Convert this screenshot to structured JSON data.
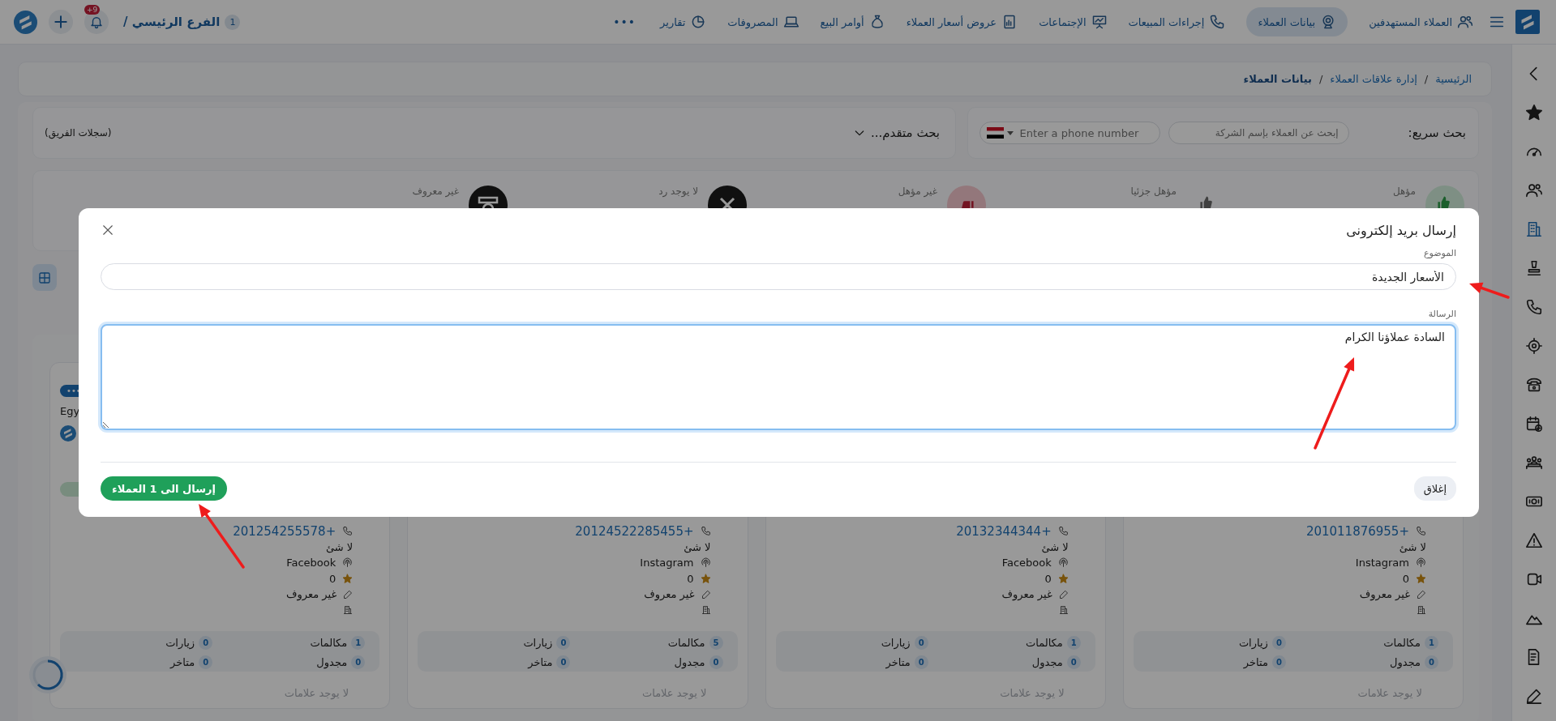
{
  "top_bar": {
    "nav": [
      {
        "label": "العملاء المستهدفين",
        "selected": false
      },
      {
        "label": "بيانات العملاء",
        "selected": true
      },
      {
        "label": "إجراءات المبيعات",
        "selected": false
      },
      {
        "label": "الإجتماعات",
        "selected": false
      },
      {
        "label": "عروض أسعار العملاء",
        "selected": false
      },
      {
        "label": "أوامر البيع",
        "selected": false
      },
      {
        "label": "المصروفات",
        "selected": false
      },
      {
        "label": "تقارير",
        "selected": false
      }
    ],
    "more": "•••",
    "branch_count": "1",
    "branch": "الفرع الرئيسي /",
    "notifications": "+9"
  },
  "sidebar": {
    "items": [
      {
        "selected": false
      },
      {
        "selected": false
      },
      {
        "selected": false
      },
      {
        "selected": false
      },
      {
        "selected": true
      },
      {
        "selected": false
      },
      {
        "selected": false
      },
      {
        "selected": false
      },
      {
        "selected": false
      },
      {
        "selected": false
      },
      {
        "selected": false
      },
      {
        "selected": false
      },
      {
        "selected": false
      },
      {
        "selected": false
      },
      {
        "selected": false
      },
      {
        "selected": false
      },
      {
        "selected": false
      }
    ]
  },
  "breadcrumb": {
    "items": [
      {
        "label": "الرئيسية",
        "current": false
      },
      {
        "label": "إدارة علاقات العملاء",
        "current": false
      },
      {
        "label": "بيانات العملاء",
        "current": true
      }
    ],
    "separators": [
      "/",
      "/"
    ]
  },
  "quick_search": {
    "label": "بحث سريع:",
    "company_placeholder": "إبحث عن العملاء بإسم الشركة",
    "phone_placeholder": "Enter a phone number"
  },
  "advanced_search": "بحث متقدم...",
  "team_records": "(سجلات الفريق)",
  "stats": [
    {
      "kind": "qualified",
      "label": "مؤهل"
    },
    {
      "kind": "partial",
      "label": "مؤهل جزئيا"
    },
    {
      "kind": "unqualified",
      "label": "غير مؤهل"
    },
    {
      "kind": "no_reply",
      "label": "لا يوجد رد"
    },
    {
      "kind": "unknown",
      "label": "غير معروف"
    }
  ],
  "cards": [
    {
      "phone": "+201011876955",
      "note": "لا شئ",
      "source": "Instagram",
      "rating": "0",
      "rank": "غير معروف",
      "calls_label": "مكالمات",
      "calls": "1",
      "visits_label": "زيارات",
      "visits": "0",
      "scheduled_label": "مجدول",
      "scheduled": "0",
      "late_label": "متاخر",
      "late": "0",
      "tags": "لا يوجد علامات"
    },
    {
      "phone": "+20132344344",
      "note": "لا شئ",
      "source": "Facebook",
      "rating": "0",
      "rank": "غير معروف",
      "calls_label": "مكالمات",
      "calls": "1",
      "visits_label": "زيارات",
      "visits": "0",
      "scheduled_label": "مجدول",
      "scheduled": "0",
      "late_label": "متاخر",
      "late": "0",
      "tags": "لا يوجد علامات"
    },
    {
      "phone": "+20124522285455",
      "note": "لا شئ",
      "source": "Instagram",
      "rating": "0",
      "rank": "غير معروف",
      "calls_label": "مكالمات",
      "calls": "5",
      "visits_label": "زيارات",
      "visits": "0",
      "scheduled_label": "مجدول",
      "scheduled": "0",
      "late_label": "متاخر",
      "late": "0",
      "tags": "لا يوجد علامات"
    },
    {
      "menu": "•••",
      "country": "Egy",
      "phone": "+201254255578",
      "note": "لا شئ",
      "source": "Facebook",
      "rating": "0",
      "rank": "غير معروف",
      "calls_label": "مكالمات",
      "calls": "1",
      "visits_label": "زيارات",
      "visits": "0",
      "scheduled_label": "مجدول",
      "scheduled": "0",
      "late_label": "متاخر",
      "late": "0",
      "tags": "لا يوجد علامات"
    }
  ],
  "modal": {
    "title": "إرسال بريد إلكترونى",
    "subject_label": "الموضوع",
    "subject": "الأسعار الجديدة",
    "message_label": "الرسالة",
    "message": "السادة عملاؤنا الكرام",
    "close": "إغلاق",
    "send": "إرسال الى 1 العملاء"
  }
}
